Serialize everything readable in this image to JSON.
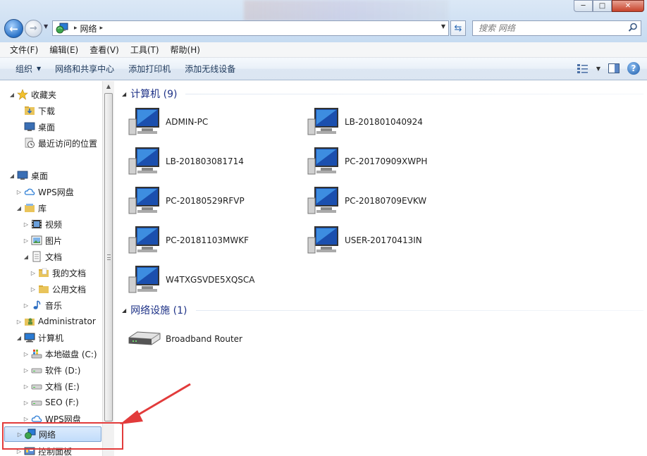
{
  "window": {
    "minimize_label": "─",
    "maximize_label": "□",
    "close_label": "✕"
  },
  "address": {
    "path": "网络",
    "search_placeholder": "搜索 网络"
  },
  "menu": {
    "items": [
      "文件(F)",
      "编辑(E)",
      "查看(V)",
      "工具(T)",
      "帮助(H)"
    ]
  },
  "commands": {
    "organize": "组织",
    "network_center": "网络和共享中心",
    "add_printer": "添加打印机",
    "add_wireless": "添加无线设备"
  },
  "nav": {
    "favorites": "收藏夹",
    "downloads": "下载",
    "desktop_fav": "桌面",
    "recent": "最近访问的位置",
    "desktop": "桌面",
    "wps": "WPS网盘",
    "library": "库",
    "video": "视频",
    "pictures": "图片",
    "documents": "文档",
    "my_docs": "我的文档",
    "public_docs": "公用文档",
    "music": "音乐",
    "admin": "Administrator",
    "computer": "计算机",
    "drive_c": "本地磁盘 (C:)",
    "drive_d": "软件 (D:)",
    "drive_e": "文档 (E:)",
    "drive_f": "SEO (F:)",
    "wps2": "WPS网盘",
    "network": "网络",
    "control_panel": "控制面板"
  },
  "content": {
    "computers_header": "计算机 (9)",
    "computers": [
      "ADMIN-PC",
      "LB-201801040924",
      "LB-201803081714",
      "PC-20170909XWPH",
      "PC-20180529RFVP",
      "PC-20180709EVKW",
      "PC-20181103MWKF",
      "USER-20170413IN",
      "W4TXGSVDE5XQSCA"
    ],
    "devices_header": "网络设施 (1)",
    "router": "Broadband Router"
  },
  "colors": {
    "accent_red": "#e23b3b",
    "group_header": "#1e3287"
  }
}
